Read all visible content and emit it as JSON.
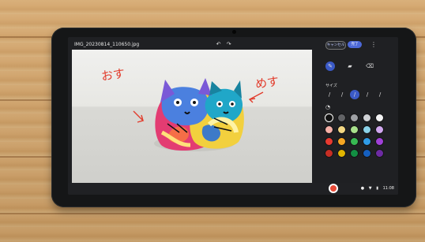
{
  "editor": {
    "file_name": "IMG_20230814_110650.jpg",
    "cancel_label": "キャンセル",
    "done_label": "完了",
    "size_label": "サイズ",
    "annotations": {
      "left": "おす",
      "right": "めす"
    }
  },
  "status": {
    "time": "11:08"
  },
  "palette": {
    "colors": [
      "#111111",
      "#626366",
      "#9ea0a4",
      "#cfd1d5",
      "#f3f3f4",
      "#f6b1a8",
      "#f3d784",
      "#a8e08c",
      "#8bd2e9",
      "#d0a7ef",
      "#e83a30",
      "#f5a623",
      "#37b852",
      "#2f9be6",
      "#a040d8",
      "#c72e24",
      "#e0b400",
      "#128f43",
      "#155fbf",
      "#6d2ba3"
    ]
  }
}
